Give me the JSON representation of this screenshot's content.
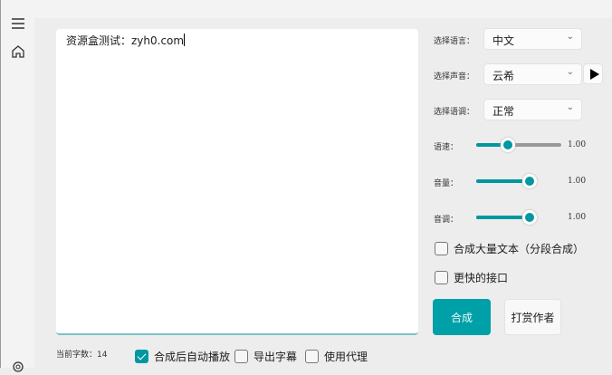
{
  "editor": {
    "text": "资源盒测试：zyh0.com"
  },
  "settings": {
    "language": {
      "label": "选择语言：",
      "value": "中文"
    },
    "voice": {
      "label": "选择声音：",
      "value": "云希"
    },
    "style": {
      "label": "选择语调：",
      "value": "正常"
    },
    "speed": {
      "label": "语速：",
      "value": "1.00",
      "position": 0.37
    },
    "volume": {
      "label": "音量：",
      "value": "1.00",
      "position": 0.9
    },
    "pitch": {
      "label": "音调：",
      "value": "1.00",
      "position": 0.9
    }
  },
  "options": {
    "batch": {
      "label": "合成大量文本（分段合成）",
      "checked": false
    },
    "fast": {
      "label": "更快的接口",
      "checked": false
    },
    "autoplay": {
      "label": "合成后自动播放",
      "checked": true
    },
    "subtitles": {
      "label": "导出字幕",
      "checked": false
    },
    "proxy": {
      "label": "使用代理",
      "checked": false
    }
  },
  "buttons": {
    "synthesize": "合成",
    "donate": "打赏作者"
  },
  "status": {
    "char_count": "当前字数：14"
  },
  "colors": {
    "accent": "#00a0a8"
  }
}
